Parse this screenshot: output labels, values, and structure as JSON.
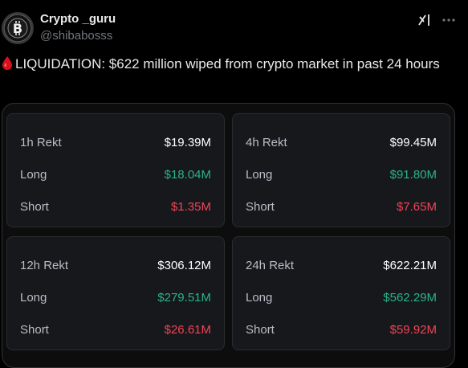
{
  "tweet": {
    "author_name": "Crypto _guru",
    "author_handle": "@shibabosss",
    "text": "LIQUIDATION: $622 million wiped from crypto market in past 24 hours",
    "icons": {
      "avatar": "bitcoin-logo",
      "drop": "blood-drop",
      "grok": "grok-icon",
      "more": "more-options-icon"
    }
  },
  "liquidation": {
    "panels": [
      {
        "label": "1h Rekt",
        "total": "$19.39M",
        "long_label": "Long",
        "long": "$18.04M",
        "short_label": "Short",
        "short": "$1.35M"
      },
      {
        "label": "4h Rekt",
        "total": "$99.45M",
        "long_label": "Long",
        "long": "$91.80M",
        "short_label": "Short",
        "short": "$7.65M"
      },
      {
        "label": "12h Rekt",
        "total": "$306.12M",
        "long_label": "Long",
        "long": "$279.51M",
        "short_label": "Short",
        "short": "$26.61M"
      },
      {
        "label": "24h Rekt",
        "total": "$622.21M",
        "long_label": "Long",
        "long": "$562.29M",
        "short_label": "Short",
        "short": "$59.92M"
      }
    ]
  },
  "colors": {
    "background": "#000000",
    "card": "#0d0d0e",
    "panel": "#17181c",
    "long": "#29b38a",
    "short": "#f14456",
    "handle": "#71767b"
  }
}
